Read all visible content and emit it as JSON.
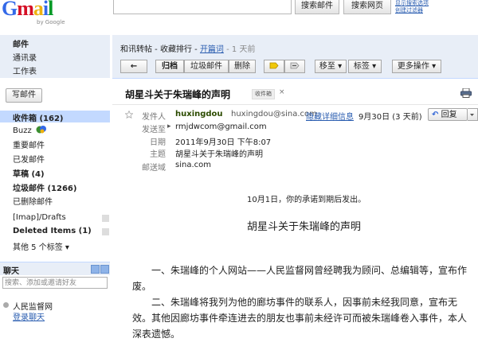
{
  "header": {
    "logo_letters": [
      "G",
      "m",
      "a",
      "i",
      "l"
    ],
    "logo_colors": [
      "#3369e8",
      "#d50f25",
      "#eeb211",
      "#3369e8",
      "#009925"
    ],
    "by_google": "by Google",
    "search_mail_button": "搜索邮件",
    "search_web_button": "搜索网页",
    "toplink_1": "显示搜索选项",
    "toplink_2": "创建过滤器"
  },
  "nav": {
    "top_items": [
      "邮件",
      "通讯录",
      "工作表"
    ],
    "compose": "写邮件",
    "folders": [
      {
        "label": "收件箱 (162)",
        "bold": true,
        "selected": true
      },
      {
        "label": "Buzz",
        "bold": false
      },
      {
        "label": "重要邮件",
        "bold": false
      },
      {
        "label": "已发邮件",
        "bold": false
      },
      {
        "label": "草稿 (4)",
        "bold": true
      },
      {
        "label": "垃圾邮件 (1266)",
        "bold": true
      },
      {
        "label": "已删除邮件",
        "bold": false
      }
    ],
    "labels": [
      {
        "label": "[Imap]/Drafts",
        "bold": false
      },
      {
        "label": "Deleted Items (1)",
        "bold": true
      }
    ],
    "more_labels": "其他 5 个标签 ▾"
  },
  "chat": {
    "title": "聊天",
    "search_placeholder": "搜索、添加或邀请好友",
    "user_name": "人民监督网",
    "login_link": "登录聊天"
  },
  "breadcrumb": {
    "prefix": "和讯转帖 - 收藏排行 - ",
    "link": "开篇词",
    "age": " - 1 天前"
  },
  "toolbar": {
    "back": "←",
    "archive": "归档",
    "spam": "垃圾邮件",
    "delete": "删除",
    "move_to": "移至 ▾",
    "labels": "标签 ▾",
    "more": "更多操作 ▾"
  },
  "message": {
    "subject": "胡星斗关于朱瑞峰的声明",
    "tag": "收件箱",
    "tag_close": "×",
    "header_labels": {
      "from": "发件人",
      "to": "发送至",
      "date": "日期",
      "subject": "主题",
      "mailed_by": "邮送域"
    },
    "from_name": "huxingdou",
    "from_email": "huxingdou@sina.com",
    "show_details": "隐藏详细信息",
    "date_short": "9月30日 (3 天前)",
    "reply": "回复",
    "to": "rmjdwcom@gmail.com",
    "date_full": "2011年9月30日 下午8:07",
    "subject_line": "胡星斗关于朱瑞峰的声明",
    "mailed_by": "sina.com"
  },
  "body": {
    "notice": "10月1日，你的承诺到期后发出。",
    "title": "胡星斗关于朱瑞峰的声明",
    "para1": "一、朱瑞峰的个人网站——人民监督网曾经聘我为顾问、总编辑等，宣布作废。",
    "para2": "二、朱瑞峰将我列为他的廊坊事件的联系人，因事前未经我同意，宣布无效。其他因廊坊事件牵连进去的朋友也事前未经许可而被朱瑞峰卷入事件，本人深表遗憾。"
  }
}
